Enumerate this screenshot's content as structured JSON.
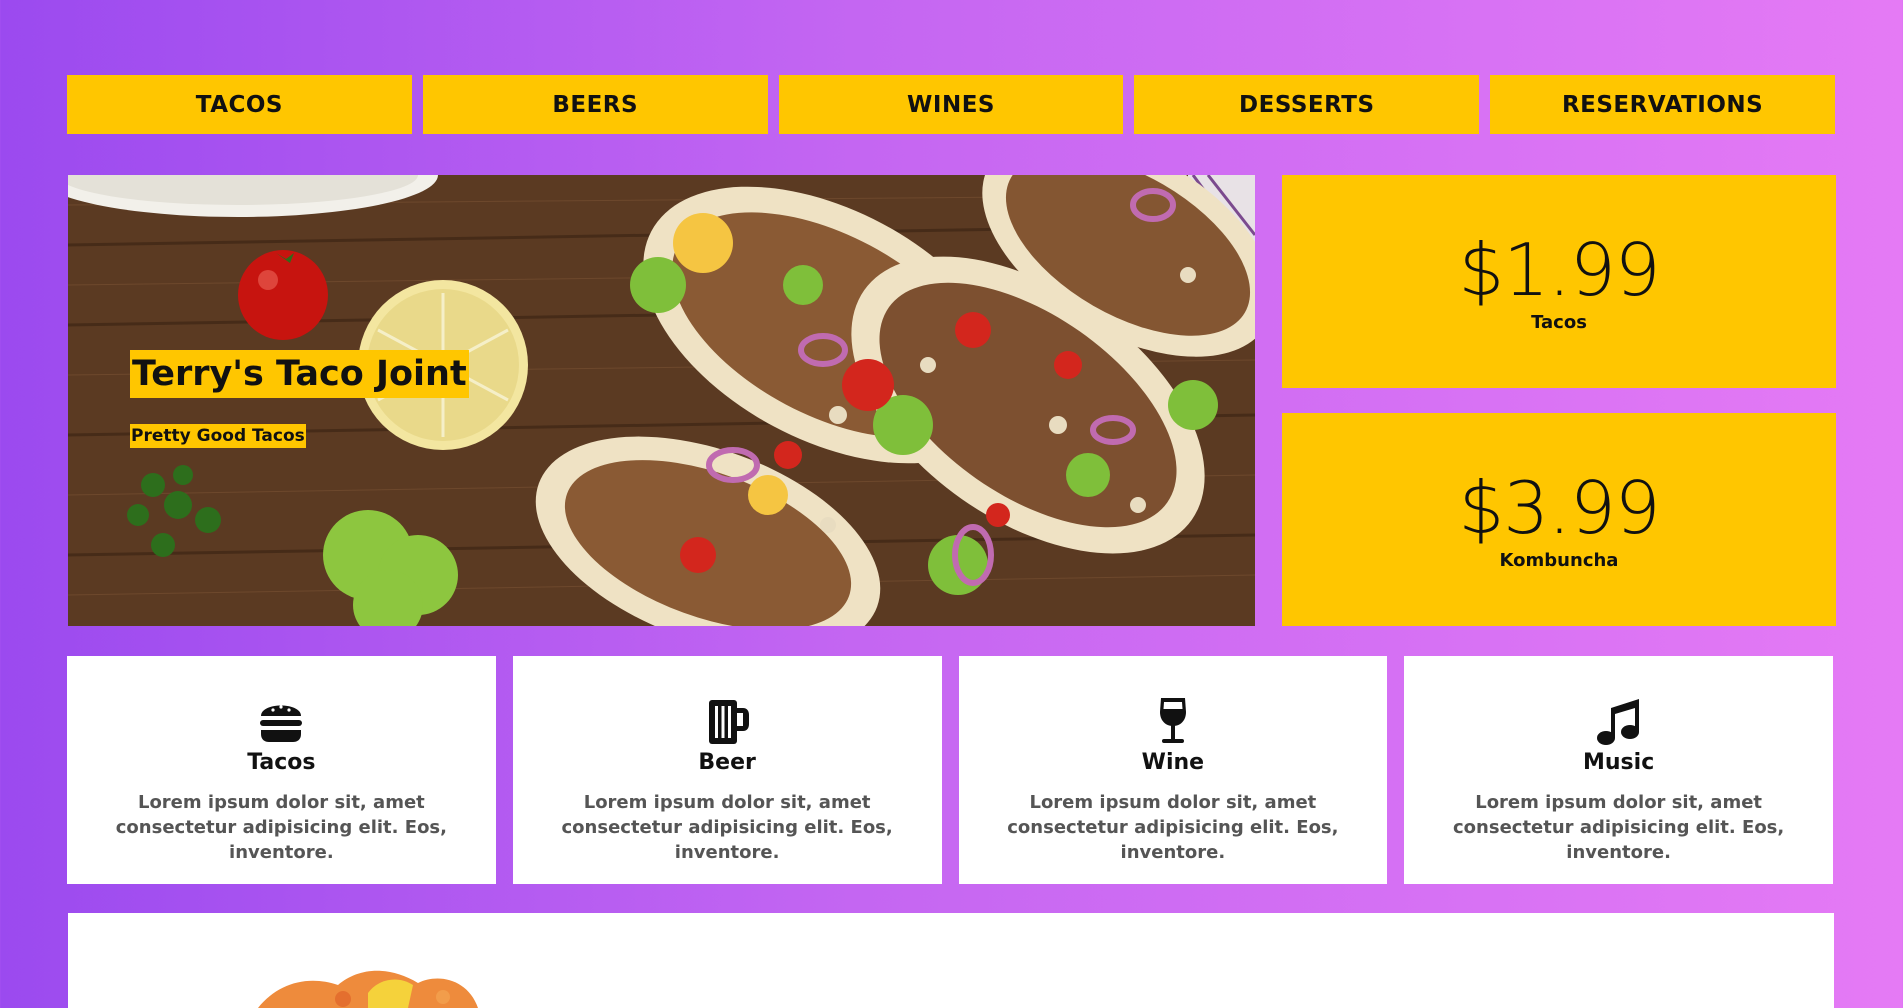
{
  "nav": {
    "items": [
      {
        "label": "TACOS"
      },
      {
        "label": "BEERS"
      },
      {
        "label": "WINES"
      },
      {
        "label": "DESSERTS"
      },
      {
        "label": "RESERVATIONS"
      }
    ]
  },
  "hero": {
    "title": "Terry's Taco Joint",
    "subtitle": "Pretty Good Tacos"
  },
  "prices": [
    {
      "amount": "$1.99",
      "label": "Tacos"
    },
    {
      "amount": "$3.99",
      "label": "Kombuncha"
    }
  ],
  "features": [
    {
      "icon": "hamburger-icon",
      "title": "Tacos",
      "text": "Lorem ipsum dolor sit, amet consectetur adipisicing elit. Eos, inventore."
    },
    {
      "icon": "beer-mug-icon",
      "title": "Beer",
      "text": "Lorem ipsum dolor sit, amet consectetur adipisicing elit. Eos, inventore."
    },
    {
      "icon": "wine-glass-icon",
      "title": "Wine",
      "text": "Lorem ipsum dolor sit, amet consectetur adipisicing elit. Eos, inventore."
    },
    {
      "icon": "music-note-icon",
      "title": "Music",
      "text": "Lorem ipsum dolor sit, amet consectetur adipisicing elit. Eos, inventore."
    }
  ],
  "colors": {
    "accent": "#ffc600",
    "gradient_start": "#9b4aef",
    "gradient_end": "#e57af5"
  }
}
